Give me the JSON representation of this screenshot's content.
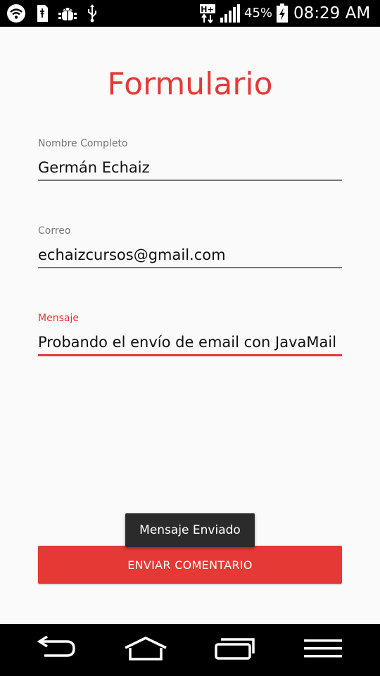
{
  "status_bar": {
    "icons": [
      "wifi-icon",
      "sd-card-icon",
      "android-debug-icon",
      "usb-icon",
      "hplus-data-icon",
      "signal-icon",
      "battery-charging-icon"
    ],
    "network_type": "H+",
    "battery_percent": "45%",
    "time": "08:29 AM"
  },
  "form": {
    "title": "Formulario",
    "fields": [
      {
        "label": "Nombre Completo",
        "value": "Germán Echaiz",
        "focused": false
      },
      {
        "label": "Correo",
        "value": "echaizcursos@gmail.com",
        "focused": false
      },
      {
        "label": "Mensaje",
        "value": "Probando el envío de email con JavaMail",
        "focused": true
      }
    ],
    "submit_label": "ENVIAR COMENTARIO"
  },
  "toast": {
    "message": "Mensaje Enviado"
  },
  "nav_bar": {
    "buttons": [
      "back-icon",
      "home-icon",
      "recents-icon",
      "menu-icon"
    ]
  },
  "colors": {
    "accent": "#e53935",
    "background": "#fafafa",
    "status_bar": "#000000",
    "toast_bg": "#2b2b2b"
  }
}
